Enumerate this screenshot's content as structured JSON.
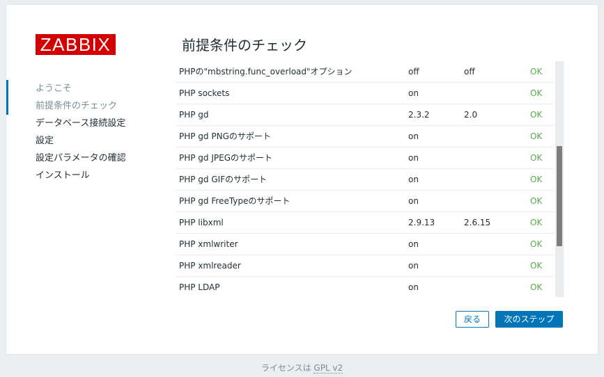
{
  "logo": "ZABBIX",
  "page_title": "前提条件のチェック",
  "nav": [
    {
      "label": "ようこそ",
      "state": "done"
    },
    {
      "label": "前提条件のチェック",
      "state": "active"
    },
    {
      "label": "データベース接続設定",
      "state": "pending"
    },
    {
      "label": "設定",
      "state": "pending"
    },
    {
      "label": "設定パラメータの確認",
      "state": "pending"
    },
    {
      "label": "インストール",
      "state": "pending"
    }
  ],
  "rows": [
    {
      "name": "PHPの\"mbstring.func_overload\"オプション",
      "current": "off",
      "required": "off",
      "result": "OK"
    },
    {
      "name": "PHP sockets",
      "current": "on",
      "required": "",
      "result": "OK"
    },
    {
      "name": "PHP gd",
      "current": "2.3.2",
      "required": "2.0",
      "result": "OK"
    },
    {
      "name": "PHP gd PNGのサポート",
      "current": "on",
      "required": "",
      "result": "OK"
    },
    {
      "name": "PHP gd JPEGのサポート",
      "current": "on",
      "required": "",
      "result": "OK"
    },
    {
      "name": "PHP gd GIFのサポート",
      "current": "on",
      "required": "",
      "result": "OK"
    },
    {
      "name": "PHP gd FreeTypeのサポート",
      "current": "on",
      "required": "",
      "result": "OK"
    },
    {
      "name": "PHP libxml",
      "current": "2.9.13",
      "required": "2.6.15",
      "result": "OK"
    },
    {
      "name": "PHP xmlwriter",
      "current": "on",
      "required": "",
      "result": "OK"
    },
    {
      "name": "PHP xmlreader",
      "current": "on",
      "required": "",
      "result": "OK"
    },
    {
      "name": "PHP LDAP",
      "current": "on",
      "required": "",
      "result": "OK"
    }
  ],
  "colors": {
    "ok": "#59a84b",
    "accent": "#0275b8",
    "logo": "#d40000"
  },
  "buttons": {
    "back": "戻る",
    "next": "次のステップ"
  },
  "footer": {
    "prefix": "ライセンスは ",
    "link": "GPL v2"
  }
}
